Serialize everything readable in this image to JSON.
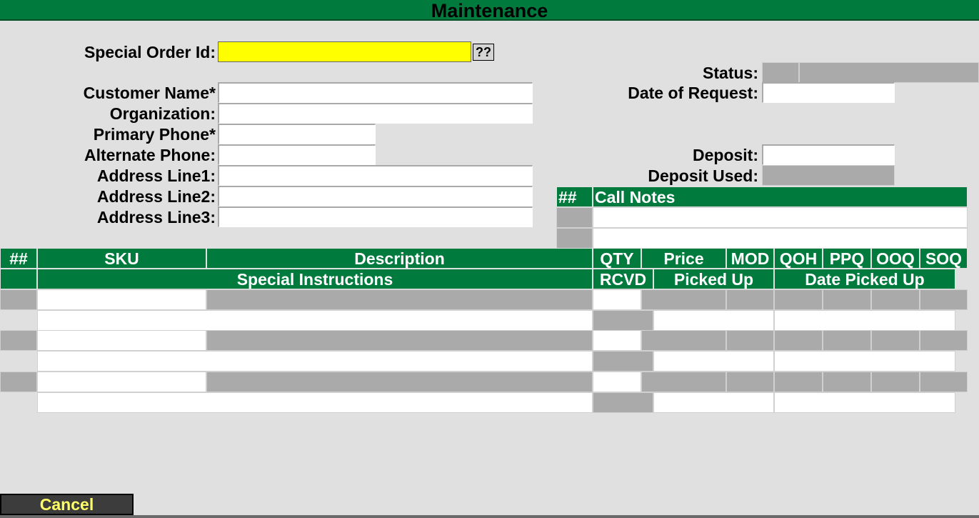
{
  "title": "Maintenance",
  "form": {
    "special_order_id_label": "Special Order Id:",
    "special_order_id_value": "",
    "lookup_button": "??",
    "customer_name_label": "Customer Name*",
    "organization_label": "Organization:",
    "primary_phone_label": "Primary Phone*",
    "alternate_phone_label": "Alternate Phone:",
    "address1_label": "Address Line1:",
    "address2_label": "Address Line2:",
    "address3_label": "Address Line3:",
    "status_label": "Status:",
    "date_of_request_label": "Date of Request:",
    "deposit_label": "Deposit:",
    "deposit_used_label": "Deposit Used:"
  },
  "call_notes": {
    "headers": [
      "##",
      "Call Notes"
    ]
  },
  "items_table": {
    "header_row1": [
      "##",
      "SKU",
      "Description",
      "QTY",
      "Price",
      "MOD",
      "QOH",
      "PPQ",
      "OOQ",
      "SOQ"
    ],
    "header_row2": [
      "Special Instructions",
      "RCVD",
      "Picked Up",
      "Date Picked Up"
    ]
  },
  "actions": {
    "cancel": "Cancel"
  },
  "colors": {
    "header_green": "#007a3d",
    "readonly_gray": "#aaaaaa",
    "highlight_yellow": "#ffff00",
    "cancel_text": "#ffff66"
  }
}
